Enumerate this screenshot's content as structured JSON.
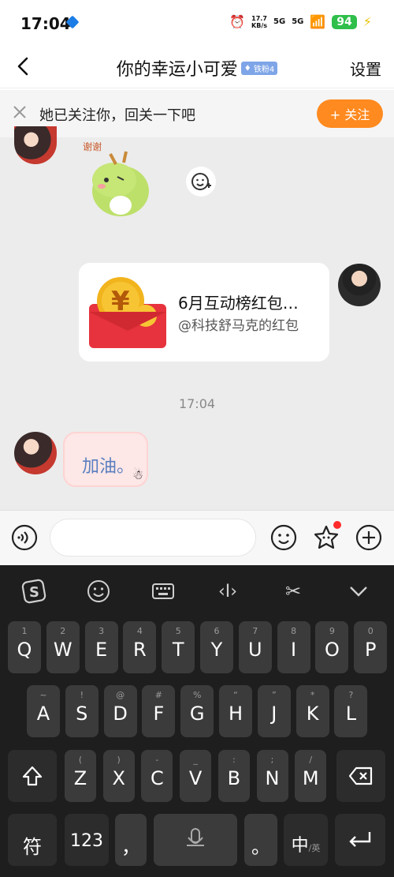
{
  "status_bar": {
    "time": "17:04",
    "net_speed_value": "17.7",
    "net_speed_unit": "KB/s",
    "signal1": "5G",
    "signal2": "5G",
    "battery": "94"
  },
  "header": {
    "title": "你的幸运小可爱",
    "fan_badge": "铁粉4",
    "settings_label": "设置"
  },
  "follow_bar": {
    "text": "她已关注你，回关一下吧",
    "follow_button": "+ 关注"
  },
  "messages": {
    "red_packet_title": "6月互动榜红包…",
    "red_packet_subtitle": "@科技舒马克的红包",
    "timestamp": "17:04",
    "text_bubble": "加油。"
  },
  "keyboard": {
    "row1": [
      {
        "k": "Q",
        "h": "1"
      },
      {
        "k": "W",
        "h": "2"
      },
      {
        "k": "E",
        "h": "3"
      },
      {
        "k": "R",
        "h": "4"
      },
      {
        "k": "T",
        "h": "5"
      },
      {
        "k": "Y",
        "h": "6"
      },
      {
        "k": "U",
        "h": "7"
      },
      {
        "k": "I",
        "h": "8"
      },
      {
        "k": "O",
        "h": "9"
      },
      {
        "k": "P",
        "h": "0"
      }
    ],
    "row2": [
      {
        "k": "A",
        "h": "~"
      },
      {
        "k": "S",
        "h": "!"
      },
      {
        "k": "D",
        "h": "@"
      },
      {
        "k": "F",
        "h": "#"
      },
      {
        "k": "G",
        "h": "%"
      },
      {
        "k": "H",
        "h": "“"
      },
      {
        "k": "J",
        "h": "”"
      },
      {
        "k": "K",
        "h": "*"
      },
      {
        "k": "L",
        "h": "?"
      }
    ],
    "row3": [
      {
        "k": "Z",
        "h": "("
      },
      {
        "k": "X",
        "h": ")"
      },
      {
        "k": "C",
        "h": "-"
      },
      {
        "k": "V",
        "h": "_"
      },
      {
        "k": "B",
        "h": ":"
      },
      {
        "k": "N",
        "h": ";"
      },
      {
        "k": "M",
        "h": "/"
      }
    ],
    "symbol_key": "符",
    "num_key": "123",
    "comma_key": "，",
    "period_key": "。",
    "lang_key": "中",
    "lang_sub": "/英"
  },
  "colors": {
    "accent": "#ff8a1f",
    "badge": "#7ea5e7",
    "battery": "#2fbf4a",
    "chat_bg": "#ececec",
    "keyboard_bg": "#1e1e1e"
  }
}
